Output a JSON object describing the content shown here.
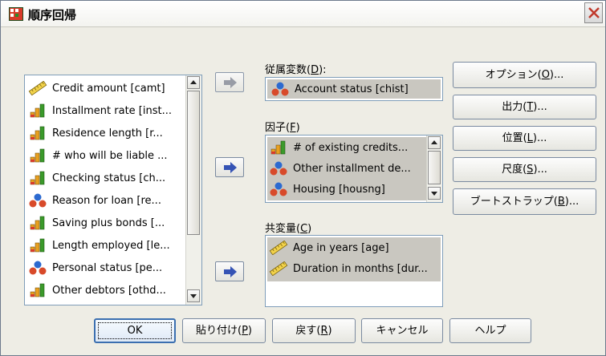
{
  "dialog": {
    "title": "順序回帰",
    "accent": "#3b6fb0",
    "background": "#eeede5"
  },
  "source_list": {
    "items": [
      {
        "label": "Credit amount [camt]",
        "icon": "scale-icon"
      },
      {
        "label": "Installment rate [inst...",
        "icon": "ordinal-icon"
      },
      {
        "label": "Residence length [r...",
        "icon": "ordinal-icon"
      },
      {
        "label": "# who will be liable ...",
        "icon": "ordinal-icon"
      },
      {
        "label": "Checking status [ch...",
        "icon": "ordinal-icon"
      },
      {
        "label": "Reason for loan [re...",
        "icon": "nominal-icon"
      },
      {
        "label": "Saving plus bonds [...",
        "icon": "ordinal-icon"
      },
      {
        "label": "Length employed [le...",
        "icon": "ordinal-icon"
      },
      {
        "label": "Personal status [pe...",
        "icon": "nominal-icon"
      },
      {
        "label": "Other debtors [othd...",
        "icon": "ordinal-icon"
      }
    ]
  },
  "dependent": {
    "label_main": "従属変数(",
    "label_key": "D",
    "label_end": "):",
    "value": "Account status [chist]",
    "icon": "nominal-icon"
  },
  "factors": {
    "label_main": "因子(",
    "label_key": "F",
    "label_end": ")",
    "items": [
      {
        "label": "# of existing credits...",
        "icon": "ordinal-icon"
      },
      {
        "label": "Other installment de...",
        "icon": "nominal-icon"
      },
      {
        "label": "Housing [housng]",
        "icon": "nominal-icon"
      }
    ]
  },
  "covariates": {
    "label_main": "共変量(",
    "label_key": "C",
    "label_end": ")",
    "items": [
      {
        "label": "Age in years [age]",
        "icon": "scale-icon"
      },
      {
        "label": "Duration in months [dur...",
        "icon": "scale-icon"
      }
    ]
  },
  "side_buttons": {
    "options": {
      "main": "オプション(",
      "key": "O",
      "end": ")..."
    },
    "output": {
      "main": "出力(",
      "key": "T",
      "end": ")..."
    },
    "location": {
      "main": "位置(",
      "key": "L",
      "end": ")..."
    },
    "scale": {
      "main": "尺度(",
      "key": "S",
      "end": ")..."
    },
    "bootstrap": {
      "main": "ブートストラップ(",
      "key": "B",
      "end": ")..."
    }
  },
  "bottom_buttons": {
    "ok": "OK",
    "paste": {
      "main": "貼り付け(",
      "key": "P",
      "end": ")"
    },
    "reset": {
      "main": "戻す(",
      "key": "R",
      "end": ")"
    },
    "cancel": "キャンセル",
    "help": "ヘルプ"
  }
}
